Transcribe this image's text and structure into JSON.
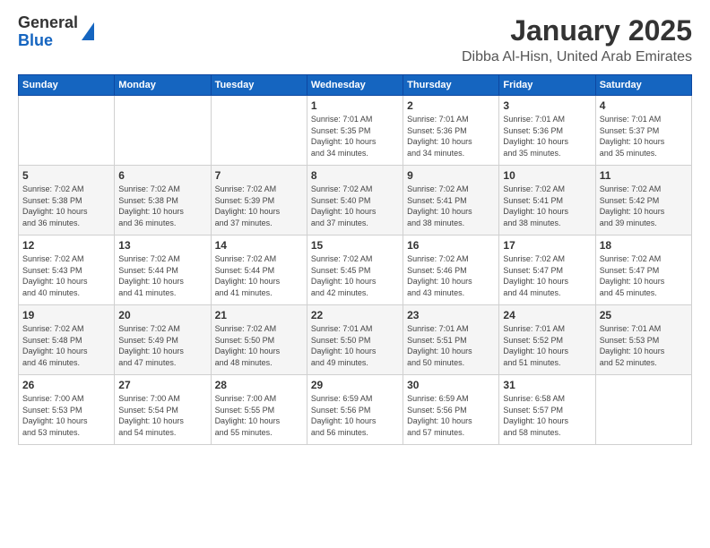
{
  "header": {
    "logo_line1": "General",
    "logo_line2": "Blue",
    "title": "January 2025",
    "subtitle": "Dibba Al-Hisn, United Arab Emirates"
  },
  "weekdays": [
    "Sunday",
    "Monday",
    "Tuesday",
    "Wednesday",
    "Thursday",
    "Friday",
    "Saturday"
  ],
  "weeks": [
    [
      {
        "day": "",
        "detail": ""
      },
      {
        "day": "",
        "detail": ""
      },
      {
        "day": "",
        "detail": ""
      },
      {
        "day": "1",
        "detail": "Sunrise: 7:01 AM\nSunset: 5:35 PM\nDaylight: 10 hours\nand 34 minutes."
      },
      {
        "day": "2",
        "detail": "Sunrise: 7:01 AM\nSunset: 5:36 PM\nDaylight: 10 hours\nand 34 minutes."
      },
      {
        "day": "3",
        "detail": "Sunrise: 7:01 AM\nSunset: 5:36 PM\nDaylight: 10 hours\nand 35 minutes."
      },
      {
        "day": "4",
        "detail": "Sunrise: 7:01 AM\nSunset: 5:37 PM\nDaylight: 10 hours\nand 35 minutes."
      }
    ],
    [
      {
        "day": "5",
        "detail": "Sunrise: 7:02 AM\nSunset: 5:38 PM\nDaylight: 10 hours\nand 36 minutes."
      },
      {
        "day": "6",
        "detail": "Sunrise: 7:02 AM\nSunset: 5:38 PM\nDaylight: 10 hours\nand 36 minutes."
      },
      {
        "day": "7",
        "detail": "Sunrise: 7:02 AM\nSunset: 5:39 PM\nDaylight: 10 hours\nand 37 minutes."
      },
      {
        "day": "8",
        "detail": "Sunrise: 7:02 AM\nSunset: 5:40 PM\nDaylight: 10 hours\nand 37 minutes."
      },
      {
        "day": "9",
        "detail": "Sunrise: 7:02 AM\nSunset: 5:41 PM\nDaylight: 10 hours\nand 38 minutes."
      },
      {
        "day": "10",
        "detail": "Sunrise: 7:02 AM\nSunset: 5:41 PM\nDaylight: 10 hours\nand 38 minutes."
      },
      {
        "day": "11",
        "detail": "Sunrise: 7:02 AM\nSunset: 5:42 PM\nDaylight: 10 hours\nand 39 minutes."
      }
    ],
    [
      {
        "day": "12",
        "detail": "Sunrise: 7:02 AM\nSunset: 5:43 PM\nDaylight: 10 hours\nand 40 minutes."
      },
      {
        "day": "13",
        "detail": "Sunrise: 7:02 AM\nSunset: 5:44 PM\nDaylight: 10 hours\nand 41 minutes."
      },
      {
        "day": "14",
        "detail": "Sunrise: 7:02 AM\nSunset: 5:44 PM\nDaylight: 10 hours\nand 41 minutes."
      },
      {
        "day": "15",
        "detail": "Sunrise: 7:02 AM\nSunset: 5:45 PM\nDaylight: 10 hours\nand 42 minutes."
      },
      {
        "day": "16",
        "detail": "Sunrise: 7:02 AM\nSunset: 5:46 PM\nDaylight: 10 hours\nand 43 minutes."
      },
      {
        "day": "17",
        "detail": "Sunrise: 7:02 AM\nSunset: 5:47 PM\nDaylight: 10 hours\nand 44 minutes."
      },
      {
        "day": "18",
        "detail": "Sunrise: 7:02 AM\nSunset: 5:47 PM\nDaylight: 10 hours\nand 45 minutes."
      }
    ],
    [
      {
        "day": "19",
        "detail": "Sunrise: 7:02 AM\nSunset: 5:48 PM\nDaylight: 10 hours\nand 46 minutes."
      },
      {
        "day": "20",
        "detail": "Sunrise: 7:02 AM\nSunset: 5:49 PM\nDaylight: 10 hours\nand 47 minutes."
      },
      {
        "day": "21",
        "detail": "Sunrise: 7:02 AM\nSunset: 5:50 PM\nDaylight: 10 hours\nand 48 minutes."
      },
      {
        "day": "22",
        "detail": "Sunrise: 7:01 AM\nSunset: 5:50 PM\nDaylight: 10 hours\nand 49 minutes."
      },
      {
        "day": "23",
        "detail": "Sunrise: 7:01 AM\nSunset: 5:51 PM\nDaylight: 10 hours\nand 50 minutes."
      },
      {
        "day": "24",
        "detail": "Sunrise: 7:01 AM\nSunset: 5:52 PM\nDaylight: 10 hours\nand 51 minutes."
      },
      {
        "day": "25",
        "detail": "Sunrise: 7:01 AM\nSunset: 5:53 PM\nDaylight: 10 hours\nand 52 minutes."
      }
    ],
    [
      {
        "day": "26",
        "detail": "Sunrise: 7:00 AM\nSunset: 5:53 PM\nDaylight: 10 hours\nand 53 minutes."
      },
      {
        "day": "27",
        "detail": "Sunrise: 7:00 AM\nSunset: 5:54 PM\nDaylight: 10 hours\nand 54 minutes."
      },
      {
        "day": "28",
        "detail": "Sunrise: 7:00 AM\nSunset: 5:55 PM\nDaylight: 10 hours\nand 55 minutes."
      },
      {
        "day": "29",
        "detail": "Sunrise: 6:59 AM\nSunset: 5:56 PM\nDaylight: 10 hours\nand 56 minutes."
      },
      {
        "day": "30",
        "detail": "Sunrise: 6:59 AM\nSunset: 5:56 PM\nDaylight: 10 hours\nand 57 minutes."
      },
      {
        "day": "31",
        "detail": "Sunrise: 6:58 AM\nSunset: 5:57 PM\nDaylight: 10 hours\nand 58 minutes."
      },
      {
        "day": "",
        "detail": ""
      }
    ]
  ]
}
